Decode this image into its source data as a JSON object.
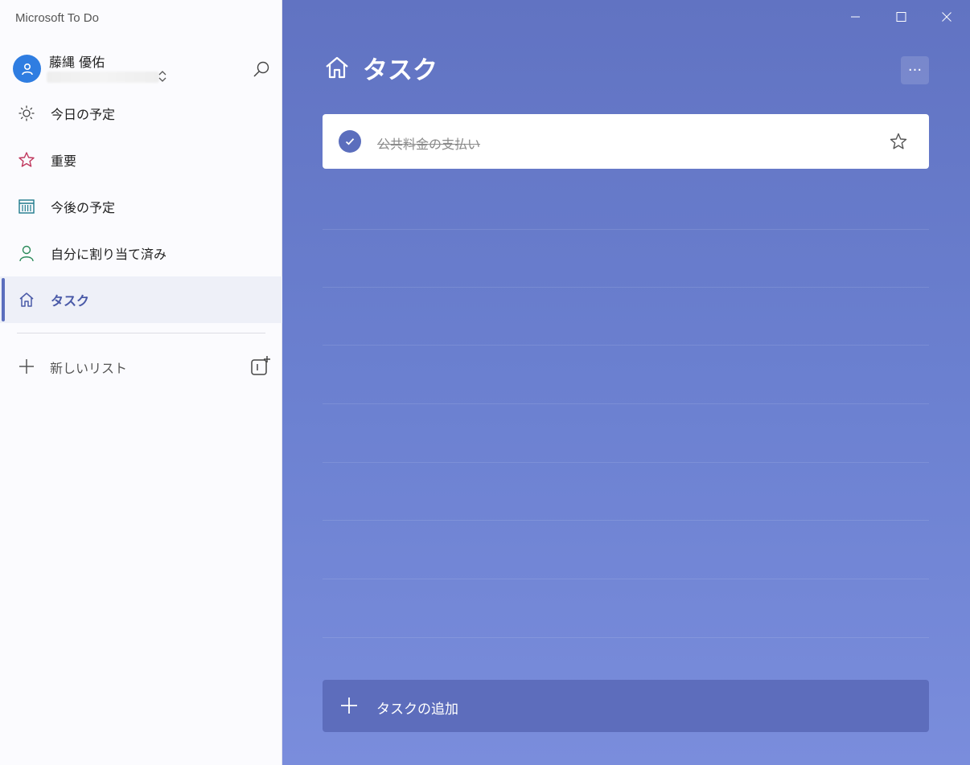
{
  "app": {
    "title": "Microsoft To Do"
  },
  "account": {
    "name": "藤縄 優佑"
  },
  "sidebar": {
    "items": [
      {
        "label": "今日の予定",
        "icon": "sun-icon"
      },
      {
        "label": "重要",
        "icon": "star-icon"
      },
      {
        "label": "今後の予定",
        "icon": "calendar-icon"
      },
      {
        "label": "自分に割り当て済み",
        "icon": "person-icon"
      },
      {
        "label": "タスク",
        "icon": "home-icon",
        "active": true
      }
    ],
    "new_list_label": "新しいリスト"
  },
  "main": {
    "title": "タスク",
    "more_label": "···",
    "tasks": [
      {
        "title": "公共料金の支払い",
        "completed": true,
        "important": false
      }
    ],
    "add_task_label": "タスクの追加"
  },
  "colors": {
    "accent": "#5b6ebd",
    "background_top": "#6173c2",
    "background_bottom": "#7a8ddc",
    "star_important": "#c0385e",
    "calendar": "#1f7a8c",
    "person": "#2a8a5a",
    "avatar": "#2f7de1"
  }
}
